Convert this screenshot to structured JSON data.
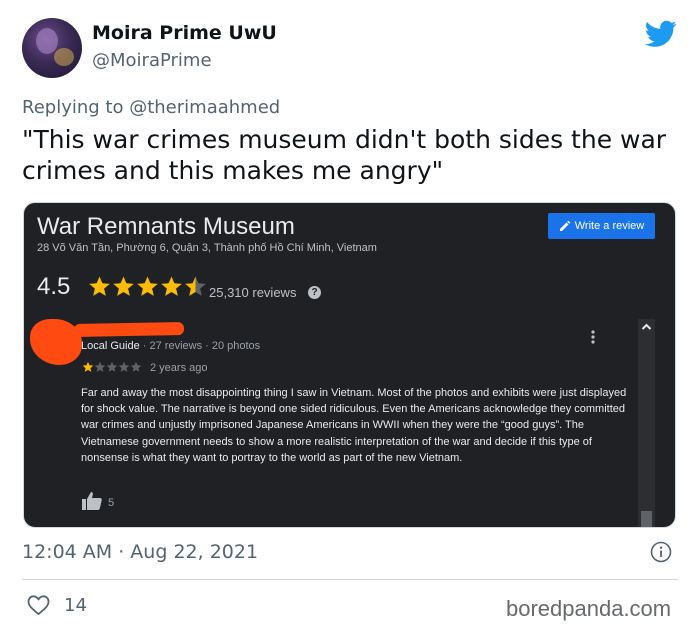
{
  "tweet": {
    "author_name": "Moira Prime UwU",
    "author_handle": "@MoiraPrime",
    "reply_prefix": "Replying to",
    "reply_to": "@therimaahmed",
    "text": "\"This war crimes museum didn't both sides the war crimes and this makes me angry\"",
    "timestamp": "12:04 AM · Aug 22, 2021",
    "like_count": "14",
    "watermark": "boredpanda.com",
    "brand_color": "#1d9bf0"
  },
  "card": {
    "title": "War Remnants Museum",
    "address": "28 Võ Văn Tần, Phường 6, Quận 3, Thành phố Hồ Chí Minh, Vietnam",
    "write_review_label": "Write a review",
    "rating": "4.5",
    "rating_value": 4.5,
    "reviews_count": "25,310 reviews",
    "help_icon": "?",
    "review": {
      "reviewer_meta_label": "Local Guide",
      "reviewer_meta_sub": " · 27 reviews · 20 photos",
      "stars": 1,
      "time_ago": "2 years ago",
      "text": "Far and away the most disappointing thing I saw in Vietnam.  Most of the photos and exhibits were just displayed for shock value.  The narrative is beyond one sided ridiculous.  Even the Americans acknowledge they committed war crimes and unjustly imprisoned Japanese Americans in WWII when they were the “good guys”.  The Vietnamese government needs to show a more realistic interpretation of the war and decide if this type of nonsense is what they want to portray to the world as part of the new Vietnam.",
      "helpful_count": "5"
    },
    "accent_color": "#1a73e8",
    "star_color": "#fbbc04",
    "redaction_color": "#ff4a12"
  }
}
